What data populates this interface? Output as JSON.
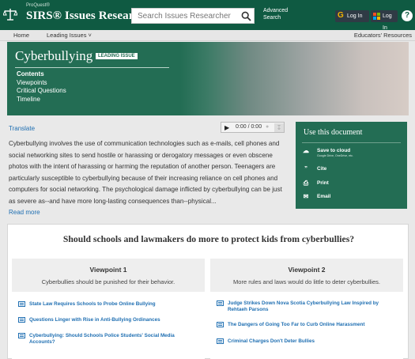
{
  "header": {
    "brand_small": "ProQuest®",
    "brand_main": "SIRS® Issues Researcher",
    "search_placeholder": "Search Issues Researcher",
    "advanced_search": "Advanced Search",
    "login_google": "Log In",
    "login_microsoft": "Log In",
    "help": "?"
  },
  "nav": {
    "home": "Home",
    "leading_issues": "Leading Issues ˅",
    "educators": "Educators' Resources"
  },
  "hero": {
    "title": "Cyberbullying",
    "badge": "LEADING ISSUE",
    "menu": [
      "Contents",
      "Viewpoints",
      "Critical Questions",
      "Timeline"
    ]
  },
  "article": {
    "translate": "Translate",
    "player_time": "0:00 / 0:00",
    "text": "Cyberbullying involves the use of communication technologies such as e-mails, cell phones and social networking sites to send hostile or harassing or derogatory messages or even obscene photos with the intent of harassing or harming the reputation of another person. Teenagers are particularly susceptible to cyberbullying because of their increasing reliance on cell phones and computers for social networking. The psychological damage inflicted by cyberbullying can be just as severe as--and have more long-lasting consequences than--physical...",
    "read_more": "Read more"
  },
  "use_doc": {
    "title": "Use this document",
    "items": [
      {
        "icon": "cloud-upload-icon",
        "label": "Save to cloud",
        "sub": "Google Drive, OneDrive, etc."
      },
      {
        "icon": "quote-icon",
        "label": "Cite",
        "sub": ""
      },
      {
        "icon": "print-icon",
        "label": "Print",
        "sub": ""
      },
      {
        "icon": "email-icon",
        "label": "Email",
        "sub": ""
      }
    ]
  },
  "viewpoints": {
    "question": "Should schools and lawmakers do more to protect kids from cyberbullies?",
    "columns": [
      {
        "title": "Viewpoint 1",
        "summary": "Cyberbullies should be punished for their behavior.",
        "links": [
          "State Law Requires Schools to Probe Online Bullying",
          "Questions Linger with Rise in Anti-Bullying Ordinances",
          "Cyberbullying: Should Schools Police Students' Social Media Accounts?"
        ]
      },
      {
        "title": "Viewpoint 2",
        "summary": "More rules and laws would do little to deter cyberbullies.",
        "links": [
          "Judge Strikes Down Nova Scotia Cyberbullying Law Inspired by Rehtaeh Parsons",
          "The Dangers of Going Too Far to Curb Online Harassment",
          "Criminal Charges Don't Deter Bullies"
        ]
      }
    ]
  },
  "colors": {
    "brand_green": "#0f5a42",
    "panel_green": "#236d54",
    "link_blue": "#1f6fb2"
  }
}
